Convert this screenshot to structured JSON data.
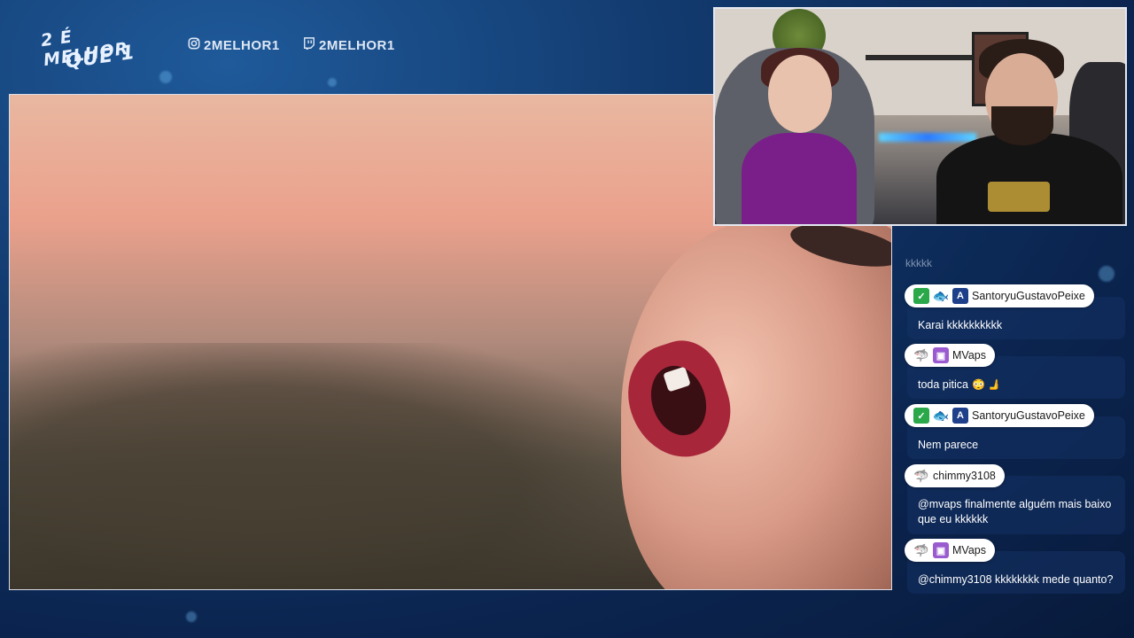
{
  "logo": {
    "line1": "2 É MELHOR",
    "line2": "QUE 1"
  },
  "social": {
    "instagram_handle": "2MELHOR1",
    "twitch_handle": "2MELHOR1"
  },
  "icons": {
    "instagram": "instagram-icon",
    "twitch": "twitch-icon",
    "verified": "sword-badge-icon",
    "fish": "fish-badge-icon",
    "tier": "a-badge-icon",
    "shark": "shark-badge-icon",
    "gift": "gift-badge-icon"
  },
  "chat": {
    "ghost_line": "kkkkk",
    "messages": [
      {
        "user": "SantoryuGustavoPeixe",
        "text": "Karai kkkkkkkkkk",
        "emoji": ""
      },
      {
        "user": "MVaps",
        "text": "toda pitica",
        "emoji": "😳 🫸"
      },
      {
        "user": "SantoryuGustavoPeixe",
        "text": "Nem parece",
        "emoji": ""
      },
      {
        "user": "chimmy3108",
        "text": "@mvaps finalmente alguém mais baixo que eu kkkkkk",
        "emoji": ""
      },
      {
        "user": "MVaps",
        "text": "@chimmy3108 kkkkkkkk mede quanto?",
        "emoji": ""
      }
    ]
  },
  "colors": {
    "background": "#0b2550",
    "accent_blue": "#1e3f8a",
    "chat_pill": "#ffffff",
    "chat_box": "#143264"
  }
}
